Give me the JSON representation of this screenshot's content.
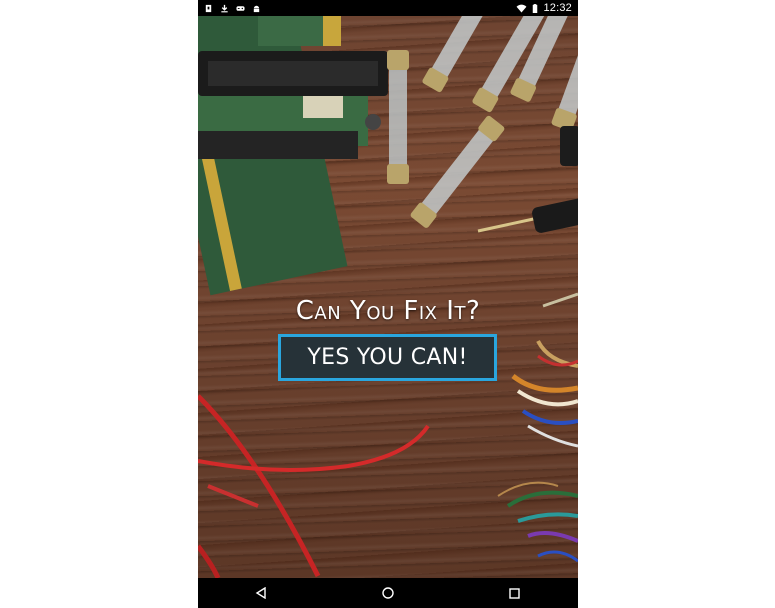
{
  "status_bar": {
    "time": "12:32",
    "left_icons": [
      "notification-icon",
      "download-icon",
      "gamepad-icon",
      "android-icon"
    ],
    "right_icons": [
      "wifi-icon",
      "battery-icon"
    ]
  },
  "main": {
    "headline": "Can You Fix It?",
    "cta_label": "YES YOU CAN!",
    "cta_border_color": "#2aa6de",
    "cta_background": "#263238"
  },
  "nav_bar": {
    "buttons": [
      "back-icon",
      "home-icon",
      "recents-icon"
    ]
  }
}
